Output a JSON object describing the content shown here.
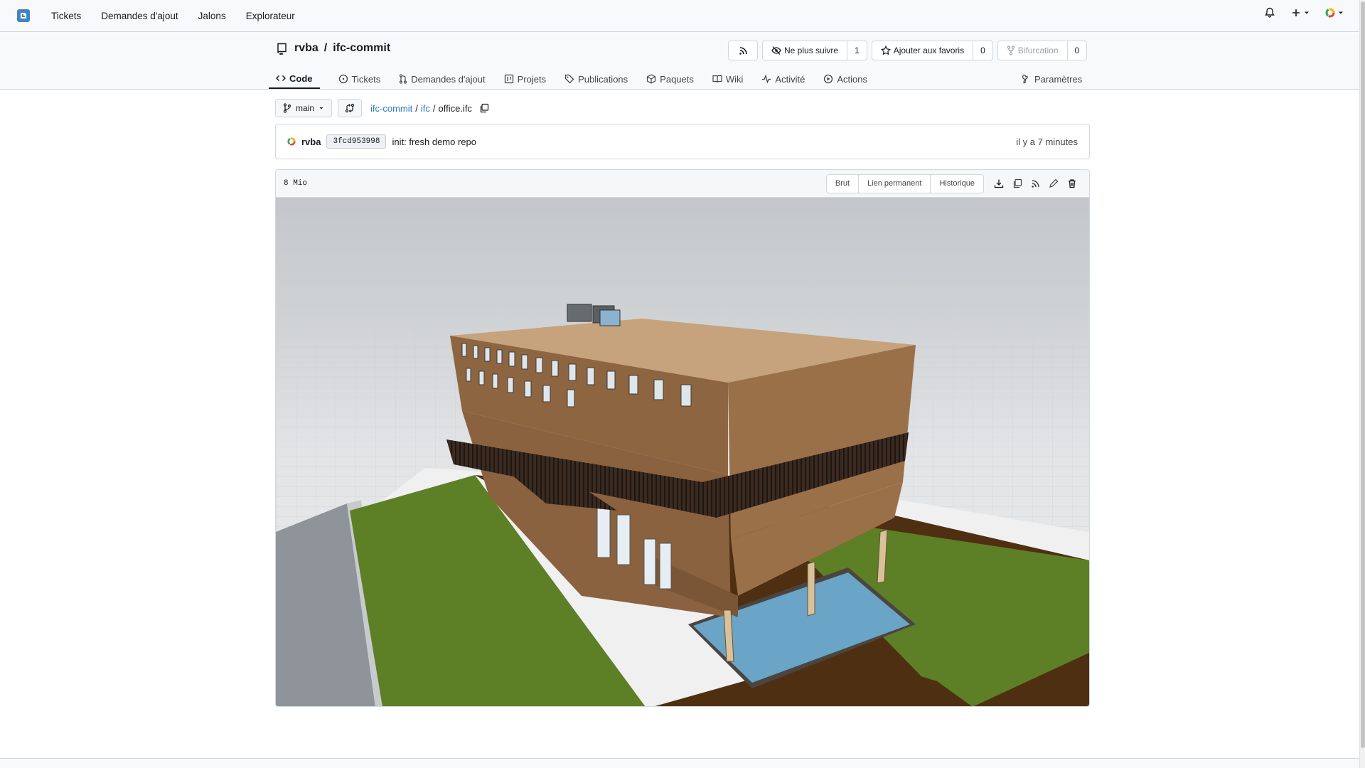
{
  "topnav": {
    "items": [
      "Tickets",
      "Demandes d'ajout",
      "Jalons",
      "Explorateur"
    ]
  },
  "repo": {
    "owner": "rvba",
    "separator": "/",
    "name": "ifc-commit",
    "buttons": {
      "unwatch_label": "Ne plus suivre",
      "unwatch_count": "1",
      "star_label": "Ajouter aux favoris",
      "star_count": "0",
      "fork_label": "Bifurcation",
      "fork_count": "0"
    },
    "tabs": [
      "Code",
      "Tickets",
      "Demandes d'ajout",
      "Projets",
      "Publications",
      "Paquets",
      "Wiki",
      "Activité",
      "Actions"
    ],
    "settings_label": "Paramètres"
  },
  "branch": {
    "name": "main",
    "path": [
      "ifc-commit",
      "ifc"
    ],
    "file": "office.ifc"
  },
  "commit": {
    "author": "rvba",
    "sha": "3fcd953998",
    "message": "init: fresh demo repo",
    "time": "il y a 7 minutes"
  },
  "file": {
    "size": "8 Mio",
    "raw_label": "Brut",
    "permalink_label": "Lien permanent",
    "history_label": "Historique"
  },
  "colors": {
    "link": "#2a7ac0",
    "border": "#d0d7de",
    "brand": "#4183c4"
  }
}
